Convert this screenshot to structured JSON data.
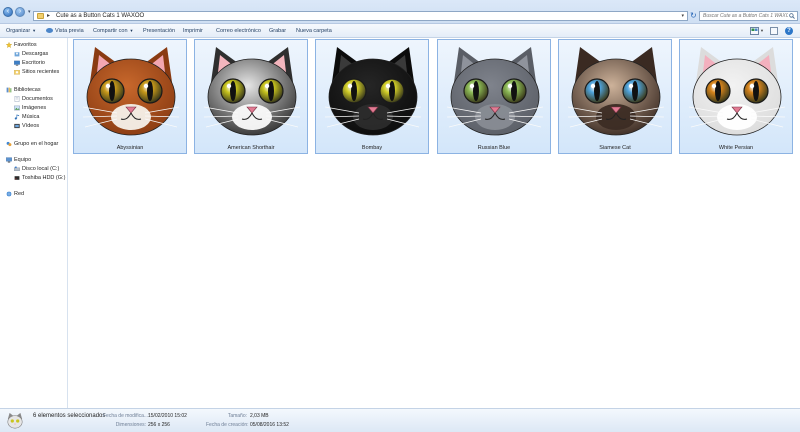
{
  "address": {
    "path": "Cute as a Button Cats 1 WAXOO",
    "search_placeholder": "Buscar Cute as a Button Cats 1 WAXOO"
  },
  "toolbar": {
    "organize": "Organizar",
    "preview": "Vista previa",
    "share": "Compartir con",
    "slideshow": "Presentación",
    "print": "Imprimir",
    "email": "Correo electrónico",
    "burn": "Grabar",
    "new_folder": "Nueva carpeta"
  },
  "sidebar": {
    "favorites": "Favoritos",
    "favorites_items": [
      "Descargas",
      "Escritorio",
      "Sitios recientes"
    ],
    "libraries": "Bibliotecas",
    "libraries_items": [
      "Documentos",
      "Imágenes",
      "Música",
      "Vídeos"
    ],
    "homegroup": "Grupo en el hogar",
    "computer": "Equipo",
    "computer_items": [
      "Disco local (C:)",
      "Toshiba HDD (G:)"
    ],
    "network": "Red"
  },
  "files": [
    {
      "name": "Abyssinian",
      "fur": "#c8682c",
      "fur2": "#8a3b12",
      "ear": "#f3a6b0",
      "eye": "#c99a1a",
      "muzzle": "#f6f1ea"
    },
    {
      "name": "American Shorthair",
      "fur": "#e6e6e6",
      "fur2": "#2f2f2f",
      "ear": "#f3b5bd",
      "eye": "#c9c51e",
      "muzzle": "#fbfbfb"
    },
    {
      "name": "Bombay",
      "fur": "#262626",
      "fur2": "#0c0c0c",
      "ear": "#3a3a3a",
      "eye": "#d3cf28",
      "muzzle": "#2c2c2c"
    },
    {
      "name": "Russian Blue",
      "fur": "#7f838c",
      "fur2": "#5a5e66",
      "ear": "#8f939c",
      "eye": "#8dbb57",
      "muzzle": "#888c94"
    },
    {
      "name": "Siamese Cat",
      "fur": "#cdb29a",
      "fur2": "#3a2a22",
      "ear": "#3a2a22",
      "eye": "#4fa3dc",
      "muzzle": "#3c2c24"
    },
    {
      "name": "White Persian",
      "fur": "#f2f2f2",
      "fur2": "#dcdcdc",
      "ear": "#f3b0be",
      "eye": "#d7841c",
      "muzzle": "#ffffff"
    }
  ],
  "status": {
    "selected": "6 elementos seleccionados",
    "modified_label": "Fecha de modifica...:",
    "modified_value": "15/02/2010 15:02",
    "dimensions_label": "Dimensiones:",
    "dimensions_value": "256 x 256",
    "size_label": "Tamaño:",
    "size_value": "2,03 MB",
    "created_label": "Fecha de creación:",
    "created_value": "05/08/2016 13:52"
  }
}
